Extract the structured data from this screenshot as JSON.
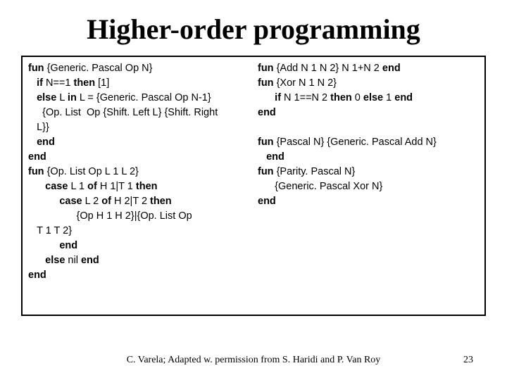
{
  "title": "Higher-order programming",
  "left": {
    "l1_a": "fun",
    "l1_b": " {Generic. Pascal Op N}",
    "l2_a": "   if",
    "l2_b": " N==1 ",
    "l2_c": "then",
    "l2_d": " [1]",
    "l3_a": "   else",
    "l3_b": " L ",
    "l3_c": "in",
    "l3_d": " L = {Generic. Pascal Op N-1}",
    "l4": "     {Op. List  Op {Shift. Left L} {Shift. Right",
    "l5": "   L}}",
    "l6_a": "   end",
    "l7_a": "end",
    "l8_a": "fun",
    "l8_b": " {Op. List Op L 1 L 2}",
    "l9_a": "      case",
    "l9_b": " L 1 ",
    "l9_c": "of",
    "l9_d": " H 1|T 1 ",
    "l9_e": "then",
    "l10_a": "           case",
    "l10_b": " L 2 ",
    "l10_c": "of",
    "l10_d": " H 2|T 2 ",
    "l10_e": "then",
    "l11": "                 {Op H 1 H 2}|{Op. List Op",
    "l12": "   T 1 T 2}",
    "l13_a": "           end",
    "l14_a": "      else",
    "l14_b": " nil ",
    "l14_c": "end",
    "l15_a": "end"
  },
  "right": {
    "r1_a": "fun",
    "r1_b": " {Add N 1 N 2} N 1+N 2 ",
    "r1_c": "end",
    "r2_a": "fun",
    "r2_b": " {Xor N 1 N 2}",
    "r3_a": "      if",
    "r3_b": " N 1==N 2 ",
    "r3_c": "then",
    "r3_d": " 0 ",
    "r3_e": "else",
    "r3_f": " 1 ",
    "r3_g": "end",
    "r4_a": "end",
    "r5": "",
    "r6_a": "fun",
    "r6_b": " {Pascal N} {Generic. Pascal Add N}",
    "r7_a": "   end",
    "r8_a": "fun",
    "r8_b": " {Parity. Pascal N}",
    "r9": "      {Generic. Pascal Xor N}",
    "r10_a": "end"
  },
  "footer": "C. Varela;  Adapted w. permission from S. Haridi and P. Van Roy",
  "page": "23"
}
